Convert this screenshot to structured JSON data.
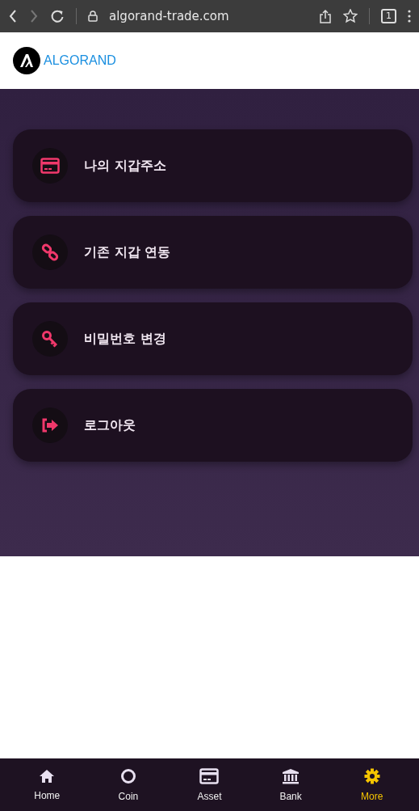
{
  "browser": {
    "url": "algorand-trade.com",
    "tab_count": "1"
  },
  "header": {
    "logo_text": "ALGORAND"
  },
  "menu": [
    {
      "kind": "card",
      "label": "나의 지갑주소"
    },
    {
      "kind": "link",
      "label": "기존 지갑 연동"
    },
    {
      "kind": "key",
      "label": "비밀번호 변경"
    },
    {
      "kind": "logout",
      "label": "로그아웃"
    }
  ],
  "bottom_nav": [
    {
      "kind": "home",
      "label": "Home",
      "selected": false
    },
    {
      "kind": "circle",
      "label": "Coin",
      "selected": false
    },
    {
      "kind": "card",
      "label": "Asset",
      "selected": false
    },
    {
      "kind": "bank",
      "label": "Bank",
      "selected": false
    },
    {
      "kind": "gear",
      "label": "More",
      "selected": true
    }
  ]
}
